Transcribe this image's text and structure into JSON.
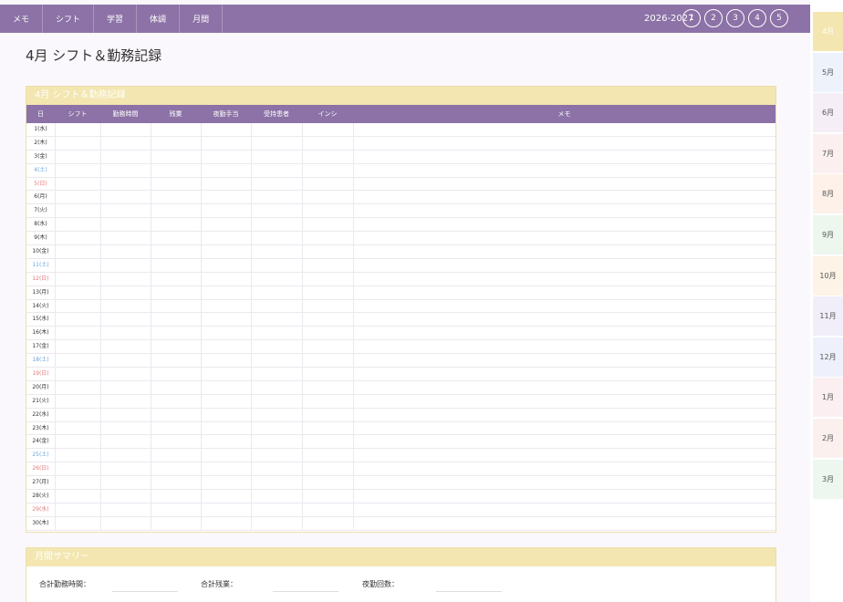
{
  "nav": {
    "tabs": [
      "メモ",
      "シフト",
      "学習",
      "体調",
      "月間"
    ],
    "year": "2026-2027",
    "circles": [
      "1",
      "2",
      "3",
      "4",
      "5"
    ]
  },
  "title": "4月 シフト＆勤務記録",
  "section": {
    "header": "4月 シフト＆勤務記録",
    "columns": [
      "日",
      "シフト",
      "勤務時間",
      "残業",
      "夜勤手当",
      "受持患者",
      "インシ",
      "メモ"
    ],
    "days": [
      {
        "label": "1(水)",
        "type": "weekday"
      },
      {
        "label": "2(木)",
        "type": "weekday"
      },
      {
        "label": "3(金)",
        "type": "weekday"
      },
      {
        "label": "4(土)",
        "type": "sat"
      },
      {
        "label": "5(日)",
        "type": "sun"
      },
      {
        "label": "6(月)",
        "type": "weekday"
      },
      {
        "label": "7(火)",
        "type": "weekday"
      },
      {
        "label": "8(水)",
        "type": "weekday"
      },
      {
        "label": "9(木)",
        "type": "weekday"
      },
      {
        "label": "10(金)",
        "type": "weekday"
      },
      {
        "label": "11(土)",
        "type": "sat"
      },
      {
        "label": "12(日)",
        "type": "sun"
      },
      {
        "label": "13(月)",
        "type": "weekday"
      },
      {
        "label": "14(火)",
        "type": "weekday"
      },
      {
        "label": "15(水)",
        "type": "weekday"
      },
      {
        "label": "16(木)",
        "type": "weekday"
      },
      {
        "label": "17(金)",
        "type": "weekday"
      },
      {
        "label": "18(土)",
        "type": "sat"
      },
      {
        "label": "19(日)",
        "type": "sun"
      },
      {
        "label": "20(月)",
        "type": "weekday"
      },
      {
        "label": "21(火)",
        "type": "weekday"
      },
      {
        "label": "22(水)",
        "type": "weekday"
      },
      {
        "label": "23(木)",
        "type": "weekday"
      },
      {
        "label": "24(金)",
        "type": "weekday"
      },
      {
        "label": "25(土)",
        "type": "sat"
      },
      {
        "label": "26(日)",
        "type": "sun"
      },
      {
        "label": "27(月)",
        "type": "weekday"
      },
      {
        "label": "28(火)",
        "type": "weekday"
      },
      {
        "label": "29(水)",
        "type": "sun"
      },
      {
        "label": "30(木)",
        "type": "weekday"
      }
    ]
  },
  "summary": {
    "header": "月間サマリー",
    "items": [
      "合計勤務時間：",
      "合計残業：",
      "夜勤回数："
    ]
  },
  "months": [
    {
      "label": "4月",
      "color": "#f3e6b0",
      "active": true
    },
    {
      "label": "5月",
      "color": "#eef3fb"
    },
    {
      "label": "6月",
      "color": "#f5eef7"
    },
    {
      "label": "7月",
      "color": "#fbeff0"
    },
    {
      "label": "8月",
      "color": "#fdf1ea"
    },
    {
      "label": "9月",
      "color": "#edf7ee"
    },
    {
      "label": "10月",
      "color": "#fdf3e6"
    },
    {
      "label": "11月",
      "color": "#f1eef9"
    },
    {
      "label": "12月",
      "color": "#eef1fb"
    },
    {
      "label": "1月",
      "color": "#fbeff1"
    },
    {
      "label": "2月",
      "color": "#fbf0ee"
    },
    {
      "label": "3月",
      "color": "#edf7ef"
    }
  ],
  "colors": {
    "nav_bg": "#8c72a6",
    "section_header": "#f3e6b0",
    "saturday": "#6aa6d8",
    "sunday": "#e07a7a"
  }
}
